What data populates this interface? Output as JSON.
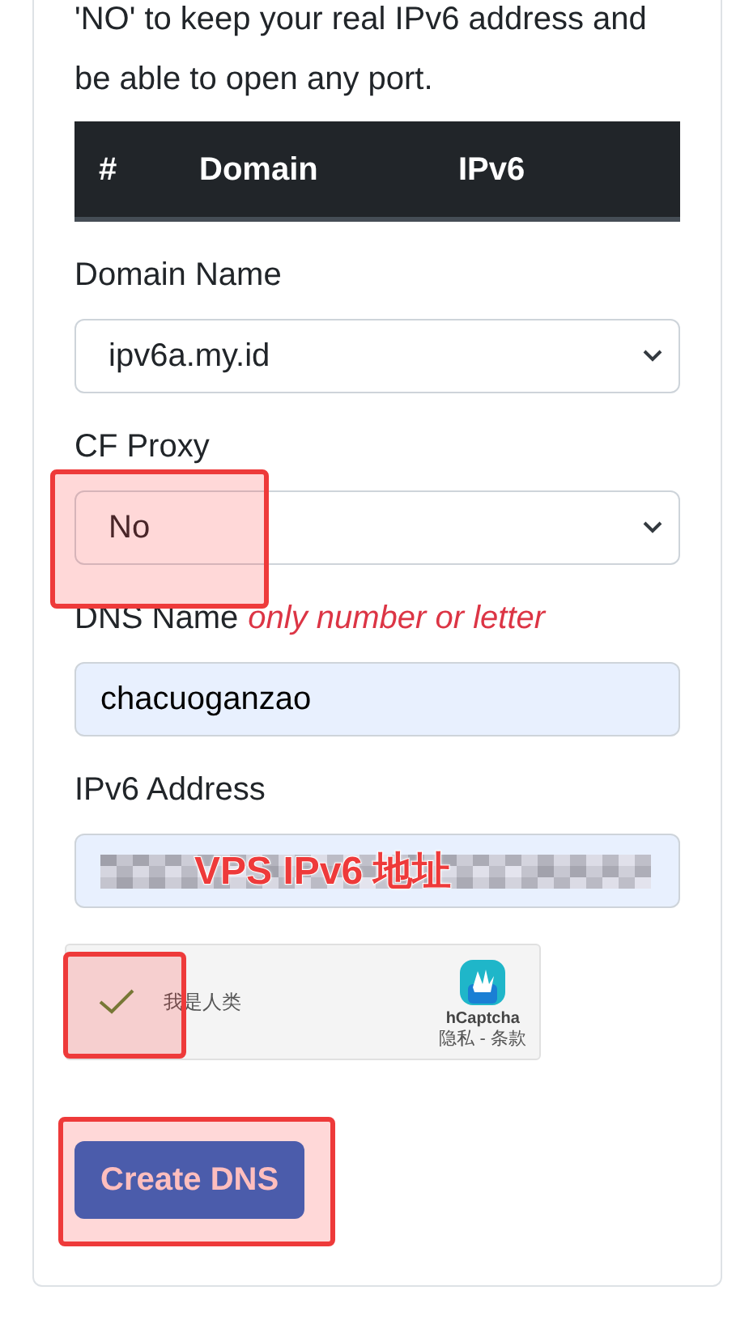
{
  "intro_text": "'NO' to keep your real IPv6 address and be able to open any port.",
  "table": {
    "columns": [
      "#",
      "Domain",
      "IPv6"
    ]
  },
  "form": {
    "fields": [
      {
        "kind": "select",
        "label": "Domain Name",
        "value": "ipv6a.my.id",
        "highlighted": false
      },
      {
        "kind": "select",
        "label": "CF Proxy",
        "value": "No",
        "highlighted": true
      },
      {
        "kind": "input",
        "label": "DNS Name",
        "hint": "only number or letter",
        "value": "chacuoganzao",
        "highlighted": false
      },
      {
        "kind": "masked",
        "label": "IPv6 Address",
        "annotation": "VPS IPv6 地址",
        "highlighted": false
      }
    ]
  },
  "captcha": {
    "checked": true,
    "label": "我是人类",
    "brand": "hCaptcha",
    "links": "隐私 - 条款",
    "highlighted": true
  },
  "submit": {
    "label": "Create DNS",
    "highlighted": true
  }
}
